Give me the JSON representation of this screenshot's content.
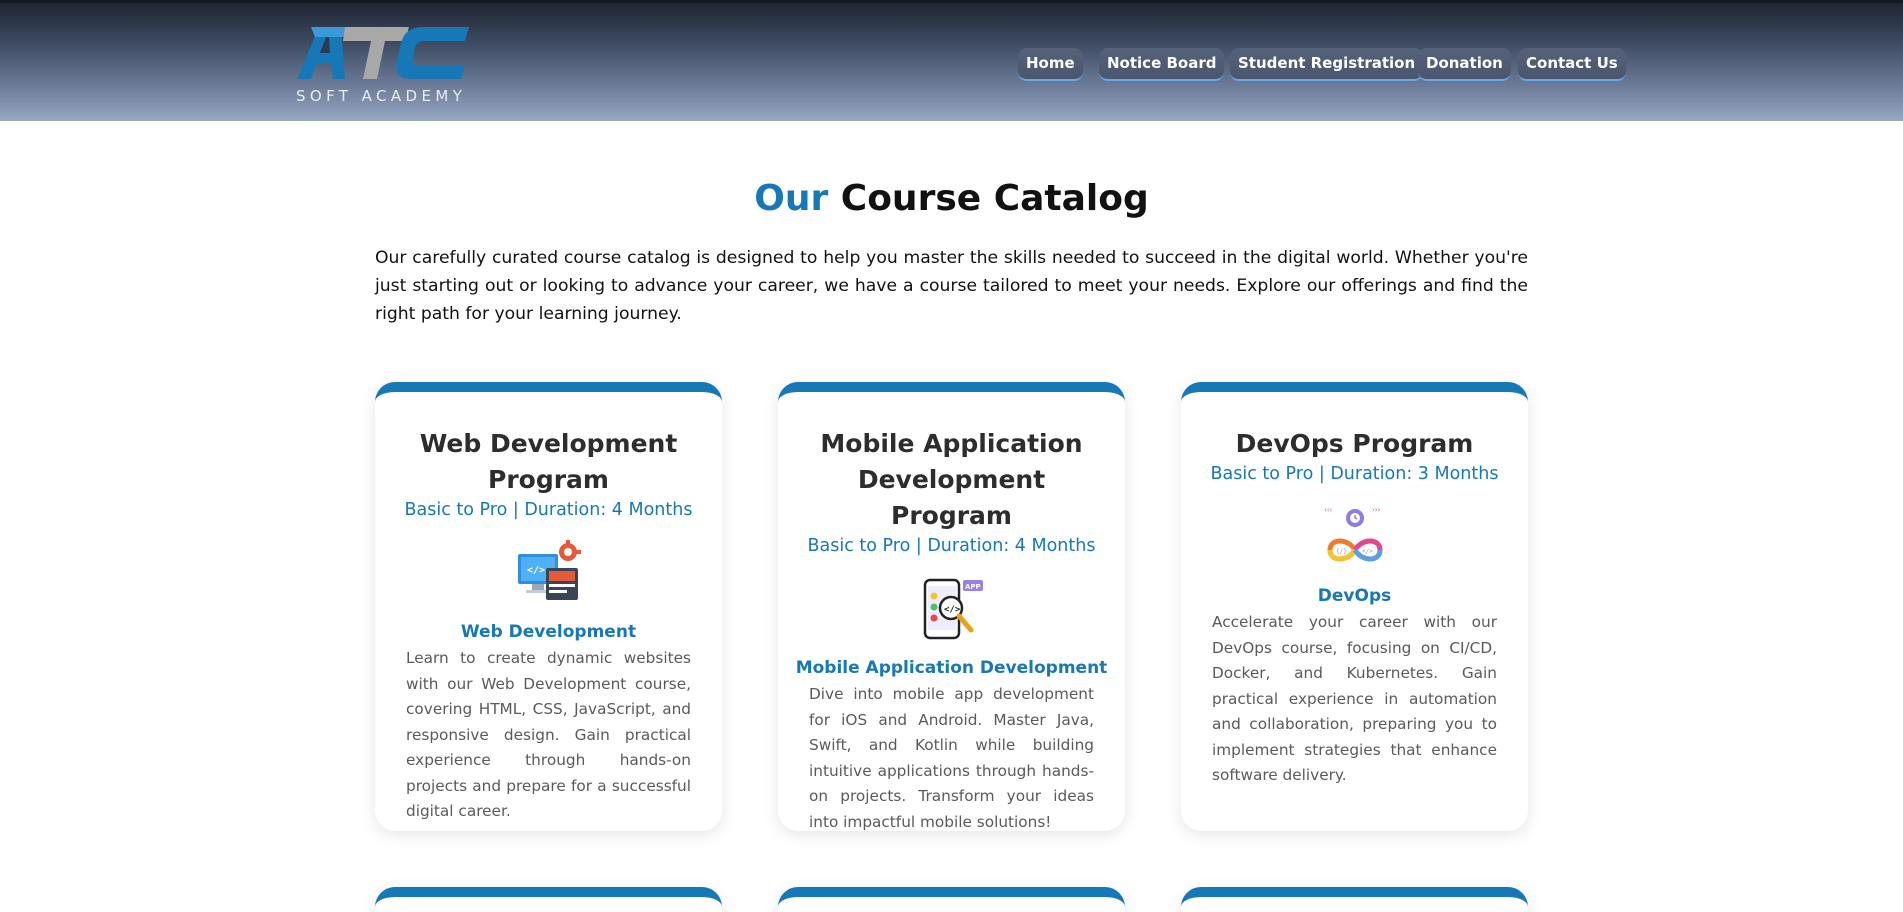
{
  "brand": {
    "logo_text": "ATC",
    "subtitle": "SOFT ACADEMY",
    "colors": {
      "primary": "#1778b8",
      "logo_light": "#3a9ad9",
      "logo_gray": "#a8a8a8"
    }
  },
  "nav": {
    "items": [
      {
        "label": "Home"
      },
      {
        "label": "Notice Board"
      },
      {
        "label": "Student Registration"
      },
      {
        "label": "Donation"
      },
      {
        "label": "Contact Us"
      }
    ]
  },
  "catalog": {
    "title_accent": "Our",
    "title_rest": "Course Catalog",
    "intro": "Our carefully curated course catalog is designed to help you master the skills needed to succeed in the digital world. Whether you're just starting out or looking to advance your career, we have a course tailored to meet your needs. Explore our offerings and find the right path for your learning journey.",
    "courses": [
      {
        "title": "Web Development Program",
        "meta": "Basic to Pro | Duration: 4 Months",
        "icon": "web-development-icon",
        "subtitle": "Web Development",
        "description": "Learn to create dynamic websites with our Web Development course, covering HTML, CSS, JavaScript, and responsive design. Gain practical experience through hands-on projects and prepare for a successful digital career."
      },
      {
        "title": "Mobile Application Development Program",
        "meta": "Basic to Pro | Duration: 4 Months",
        "icon": "mobile-app-icon",
        "subtitle": "Mobile Application Development",
        "description": "Dive into mobile app development for iOS and Android. Master Java, Swift, and Kotlin while building intuitive applications through hands-on projects. Transform your ideas into impactful mobile solutions!"
      },
      {
        "title": "DevOps Program",
        "meta": "Basic to Pro | Duration: 3 Months",
        "icon": "devops-infinity-icon",
        "subtitle": "DevOps",
        "description": "Accelerate your career with our DevOps course, focusing on CI/CD, Docker, and Kubernetes. Gain practical experience in automation and collaboration, preparing you to implement strategies that enhance software delivery."
      }
    ]
  }
}
